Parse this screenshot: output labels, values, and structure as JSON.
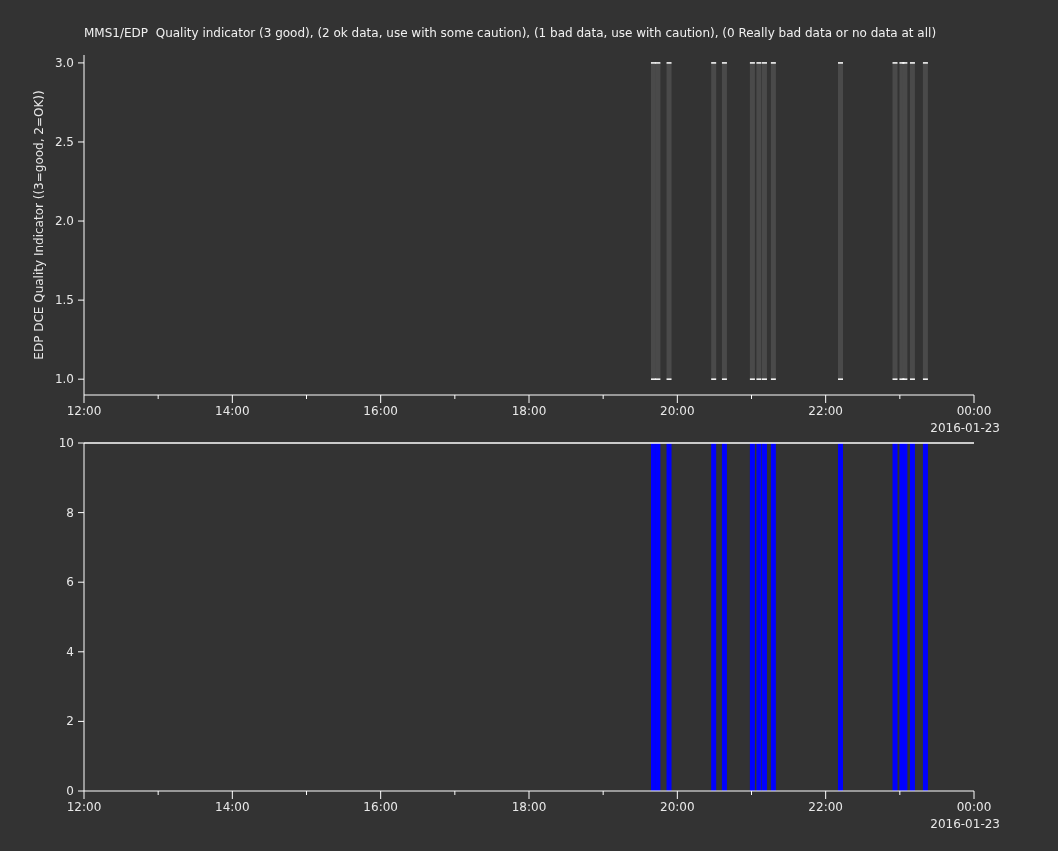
{
  "panels": [
    {
      "title": "MMS1/EDP  Quality indicator (3 good), (2 ok data, use with some caution), (1 bad data, use with caution), (0 Really bad data or no data at all)",
      "date_label": "2016-01-23",
      "chart_data": {
        "type": "area",
        "ylabel": "EDP DCE Quality Indicator ((3=good, 2=OK))",
        "x": [
          19.678,
          19.738,
          19.888,
          20.49,
          20.635,
          21.012,
          21.1,
          21.175,
          21.295,
          22.2,
          22.935,
          23.028,
          23.068,
          23.17,
          23.345
        ],
        "values": [
          3,
          3,
          3,
          3,
          3,
          3,
          3,
          3,
          3,
          3,
          3,
          3,
          3,
          3,
          3
        ],
        "xlim": [
          12,
          24
        ],
        "ylim": [
          0.9,
          3.05
        ],
        "xticks": [
          {
            "value": 12,
            "label": "12:00"
          },
          {
            "value": 14,
            "label": "14:00"
          },
          {
            "value": 16,
            "label": "16:00"
          },
          {
            "value": 18,
            "label": "18:00"
          },
          {
            "value": 20,
            "label": "20:00"
          },
          {
            "value": 22,
            "label": "22:00"
          },
          {
            "value": 24,
            "label": "00:00"
          }
        ],
        "yticks": [
          {
            "value": 1,
            "label": "1.0"
          },
          {
            "value": 1.5,
            "label": "1.5"
          },
          {
            "value": 2,
            "label": "2.0"
          },
          {
            "value": 2.5,
            "label": "2.5"
          },
          {
            "value": 3,
            "label": "3.0"
          }
        ]
      }
    },
    {
      "date_label": "2016-01-23",
      "chart_data": {
        "type": "bar",
        "x": [
          19.678,
          19.738,
          19.888,
          20.49,
          20.635,
          21.012,
          21.1,
          21.175,
          21.295,
          22.2,
          22.935,
          23.028,
          23.068,
          23.17,
          23.345
        ],
        "values": [
          10,
          10,
          10,
          10,
          10,
          10,
          10,
          10,
          10,
          10,
          10,
          10,
          10,
          10,
          10
        ],
        "xlim": [
          12,
          24
        ],
        "ylim": [
          0,
          10
        ],
        "xticks": [
          {
            "value": 12,
            "label": "12:00"
          },
          {
            "value": 14,
            "label": "14:00"
          },
          {
            "value": 16,
            "label": "16:00"
          },
          {
            "value": 18,
            "label": "18:00"
          },
          {
            "value": 20,
            "label": "20:00"
          },
          {
            "value": 22,
            "label": "22:00"
          },
          {
            "value": 24,
            "label": "00:00"
          }
        ],
        "yticks": [
          0,
          2,
          4,
          6,
          8,
          10
        ]
      }
    }
  ]
}
